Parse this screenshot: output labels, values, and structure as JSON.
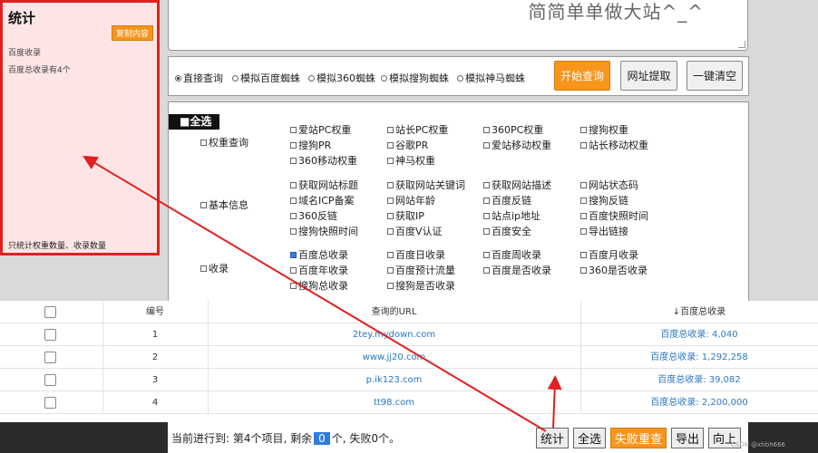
{
  "textarea": {
    "text": "简简单单做大站^_^"
  },
  "query_bar": {
    "radios": [
      {
        "label": "直接查询",
        "checked": true
      },
      {
        "label": "模拟百度蜘蛛",
        "checked": false
      },
      {
        "label": "模拟360蜘蛛",
        "checked": false
      },
      {
        "label": "模拟搜狗蜘蛛",
        "checked": false
      },
      {
        "label": "模拟神马蜘蛛",
        "checked": false
      }
    ],
    "start_btn": "开始查询",
    "url_extract_btn": "网址提取",
    "clear_btn": "一键清空"
  },
  "options": {
    "select_all": "■全选",
    "categories": [
      {
        "label": "权重查询",
        "items": [
          {
            "label": "爱站PC权重",
            "checked": false
          },
          {
            "label": "站长PC权重",
            "checked": false
          },
          {
            "label": "360PC权重",
            "checked": false
          },
          {
            "label": "搜狗权重",
            "checked": false
          },
          {
            "label": "搜狗PR",
            "checked": false
          },
          {
            "label": "谷歌PR",
            "checked": false
          },
          {
            "label": "爱站移动权重",
            "checked": false
          },
          {
            "label": "站长移动权重",
            "checked": false
          },
          {
            "label": "360移动权重",
            "checked": false
          },
          {
            "label": "神马权重",
            "checked": false
          }
        ]
      },
      {
        "label": "基本信息",
        "items": [
          {
            "label": "获取网站标题",
            "checked": false
          },
          {
            "label": "获取网站关键词",
            "checked": false
          },
          {
            "label": "获取网站描述",
            "checked": false
          },
          {
            "label": "网站状态码",
            "checked": false
          },
          {
            "label": "域名ICP备案",
            "checked": false
          },
          {
            "label": "网站年龄",
            "checked": false
          },
          {
            "label": "百度反链",
            "checked": false
          },
          {
            "label": "搜狗反链",
            "checked": false
          },
          {
            "label": "360反链",
            "checked": false
          },
          {
            "label": "获取IP",
            "checked": false
          },
          {
            "label": "站点ip地址",
            "checked": false
          },
          {
            "label": "百度快照时间",
            "checked": false
          },
          {
            "label": "搜狗快照时间",
            "checked": false
          },
          {
            "label": "百度V认证",
            "checked": false
          },
          {
            "label": "百度安全",
            "checked": false
          },
          {
            "label": "导出链接",
            "checked": false
          }
        ]
      },
      {
        "label": "收录",
        "items": [
          {
            "label": "百度总收录",
            "checked": true
          },
          {
            "label": "百度日收录",
            "checked": false
          },
          {
            "label": "百度周收录",
            "checked": false
          },
          {
            "label": "百度月收录",
            "checked": false
          },
          {
            "label": "百度年收录",
            "checked": false
          },
          {
            "label": "百度预计流量",
            "checked": false
          },
          {
            "label": "百度是否收录",
            "checked": false
          },
          {
            "label": "360是否收录",
            "checked": false
          },
          {
            "label": "搜狗总收录",
            "checked": false
          },
          {
            "label": "搜狗是否收录",
            "checked": false
          }
        ]
      }
    ]
  },
  "stats_panel": {
    "title": "统计",
    "copy_btn": "复制内容",
    "line1": "百度收录",
    "line2": "百度总收录有4个",
    "footer": "只统计权重数量、收录数量",
    "border_color": "#e02020"
  },
  "table": {
    "headers": {
      "num": "编号",
      "url": "查询的URL",
      "baidu": "↓百度总收录"
    },
    "rows": [
      {
        "num": "1",
        "url": "2tey.mydown.com",
        "baidu": "百度总收录: 4,040"
      },
      {
        "num": "2",
        "url": "www.jj20.com",
        "baidu": "百度总收录: 1,292,258"
      },
      {
        "num": "3",
        "url": "p.ik123.com",
        "baidu": "百度总收录: 39,082"
      },
      {
        "num": "4",
        "url": "tt98.com",
        "baidu": "百度总收录: 2,200,000"
      }
    ]
  },
  "bottom": {
    "progress_prefix": "当前进行到: 第4个项目, 剩余",
    "remaining": "0",
    "progress_suffix": "个, 失败0个。",
    "btn_stats": "统计",
    "btn_select_all": "全选",
    "btn_retry": "失败重查",
    "btn_export": "导出",
    "btn_up": "向上",
    "watermark": "CSDN @xhbh666"
  },
  "colors": {
    "accent": "#f7951d",
    "link": "#2a78c0",
    "annotation_arrow": "#e02020"
  }
}
